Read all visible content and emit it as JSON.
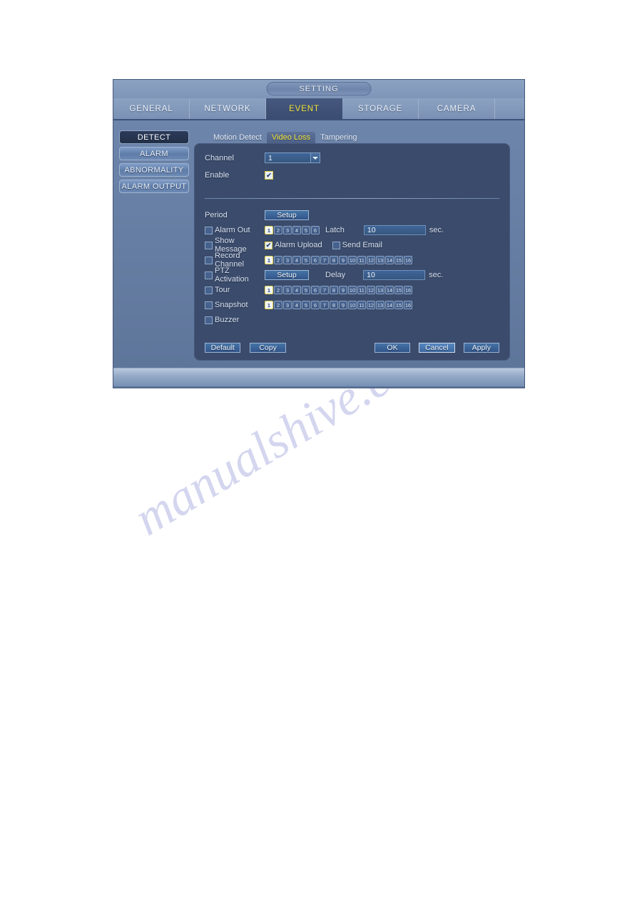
{
  "window": {
    "title": "SETTING",
    "main_tabs": [
      {
        "label": "GENERAL",
        "active": false
      },
      {
        "label": "NETWORK",
        "active": false
      },
      {
        "label": "EVENT",
        "active": true
      },
      {
        "label": "STORAGE",
        "active": false
      },
      {
        "label": "CAMERA",
        "active": false
      }
    ],
    "side_menu": [
      {
        "label": "DETECT",
        "active": true
      },
      {
        "label": "ALARM",
        "active": false
      },
      {
        "label": "ABNORMALITY",
        "active": false
      },
      {
        "label": "ALARM OUTPUT",
        "active": false
      }
    ],
    "sub_tabs": [
      {
        "label": "Motion Detect",
        "active": false
      },
      {
        "label": "Video Loss",
        "active": true
      },
      {
        "label": "Tampering",
        "active": false
      }
    ]
  },
  "form": {
    "channel_label": "Channel",
    "channel_value": "1",
    "enable_label": "Enable",
    "enable_checked": true,
    "period_label": "Period",
    "period_button": "Setup",
    "alarm_out_label": "Alarm Out",
    "alarm_out_checked": false,
    "alarm_out_chips": [
      "1",
      "2",
      "3",
      "4",
      "5",
      "6"
    ],
    "alarm_out_selected": [
      "1"
    ],
    "latch_label": "Latch",
    "latch_value": "10",
    "latch_unit": "sec.",
    "show_message_label": "Show Message",
    "show_message_checked": false,
    "alarm_upload_label": "Alarm Upload",
    "alarm_upload_checked": true,
    "send_email_label": "Send Email",
    "send_email_checked": false,
    "record_channel_label": "Record Channel",
    "record_channel_checked": false,
    "record_channel_chips": [
      "1",
      "2",
      "3",
      "4",
      "5",
      "6",
      "7",
      "8",
      "9",
      "10",
      "11",
      "12",
      "13",
      "14",
      "15",
      "16"
    ],
    "record_channel_selected": [
      "1"
    ],
    "ptz_activation_label": "PTZ Activation",
    "ptz_activation_checked": false,
    "ptz_button": "Setup",
    "delay_label": "Delay",
    "delay_value": "10",
    "delay_unit": "sec.",
    "tour_label": "Tour",
    "tour_checked": false,
    "tour_chips": [
      "1",
      "2",
      "3",
      "4",
      "5",
      "6",
      "7",
      "8",
      "9",
      "10",
      "11",
      "12",
      "13",
      "14",
      "15",
      "16"
    ],
    "tour_selected": [
      "1"
    ],
    "snapshot_label": "Snapshot",
    "snapshot_checked": false,
    "snapshot_chips": [
      "1",
      "2",
      "3",
      "4",
      "5",
      "6",
      "7",
      "8",
      "9",
      "10",
      "11",
      "12",
      "13",
      "14",
      "15",
      "16"
    ],
    "snapshot_selected": [
      "1"
    ],
    "buzzer_label": "Buzzer",
    "buzzer_checked": false
  },
  "buttons": {
    "default": "Default",
    "copy": "Copy",
    "ok": "OK",
    "cancel": "Cancel",
    "apply": "Apply"
  },
  "watermark": {
    "text": "manualshive.com"
  },
  "colors": {
    "accent_yellow": "#f2e53c",
    "panel_bg": "#3b4b6b",
    "window_bg": "#6d85ab"
  }
}
